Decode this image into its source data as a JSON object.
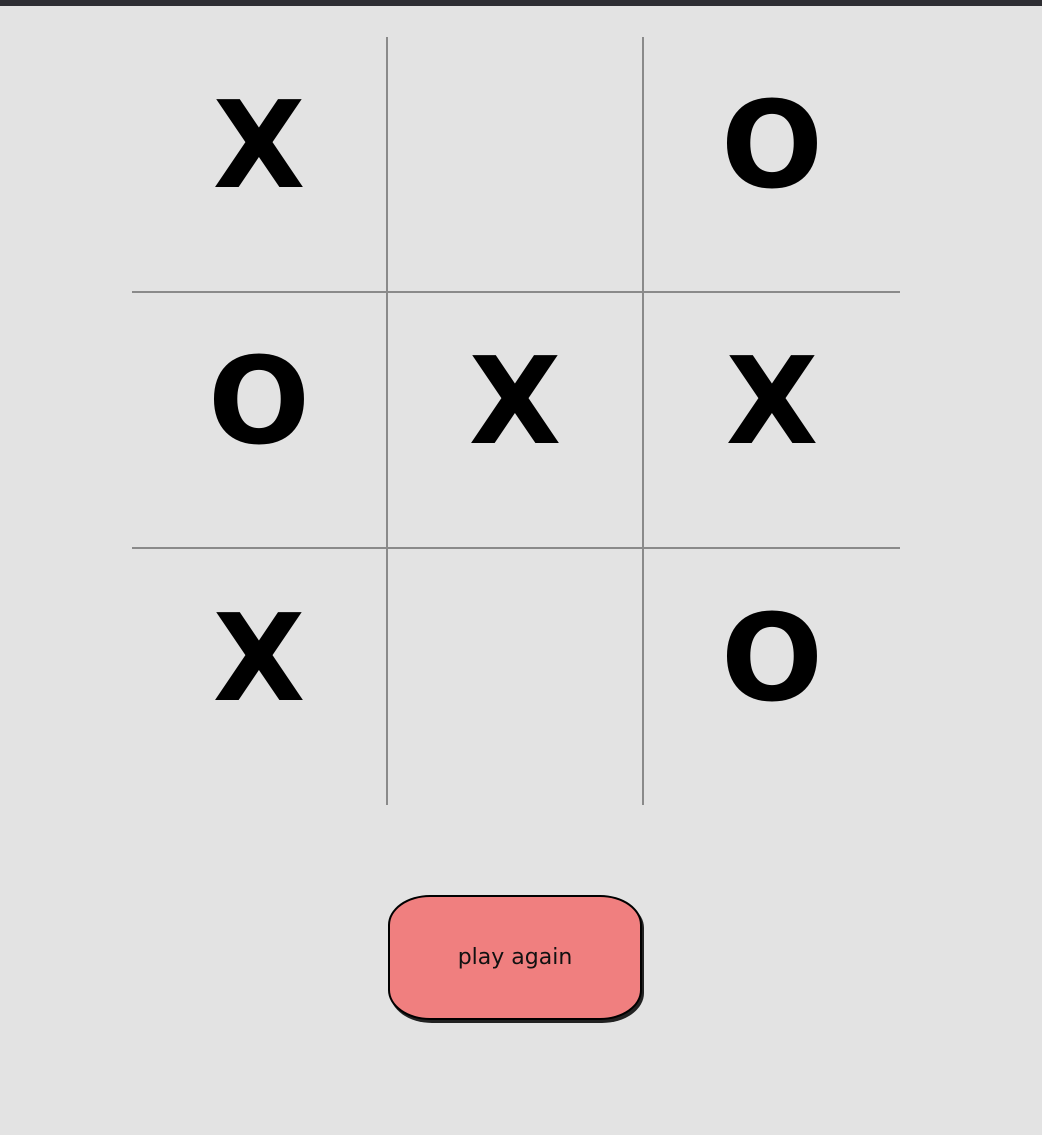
{
  "board": {
    "cells": [
      "X",
      "",
      "O",
      "O",
      "X",
      "X",
      "X",
      "",
      "O"
    ]
  },
  "controls": {
    "play_again_label": "play again"
  },
  "colors": {
    "background": "#e3e3e3",
    "grid_line": "#8a8a8a",
    "mark": "#000000",
    "button": "#f07f7f"
  }
}
